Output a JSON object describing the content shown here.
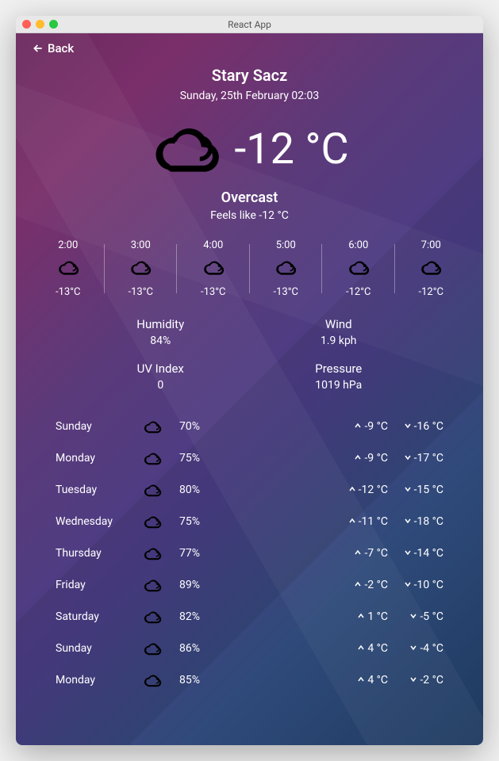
{
  "window": {
    "title": "React App"
  },
  "nav": {
    "back_label": "Back"
  },
  "location": {
    "city": "Stary Sacz",
    "datetime": "Sunday, 25th February 02:03"
  },
  "current": {
    "temp": "-12 °C",
    "condition": "Overcast",
    "feels_like": "Feels like -12 °C"
  },
  "hourly": [
    {
      "time": "2:00",
      "temp": "-13°C",
      "icon": "cloud"
    },
    {
      "time": "3:00",
      "temp": "-13°C",
      "icon": "cloud"
    },
    {
      "time": "4:00",
      "temp": "-13°C",
      "icon": "cloud"
    },
    {
      "time": "5:00",
      "temp": "-13°C",
      "icon": "cloud"
    },
    {
      "time": "6:00",
      "temp": "-12°C",
      "icon": "cloud"
    },
    {
      "time": "7:00",
      "temp": "-12°C",
      "icon": "cloud"
    }
  ],
  "stats": {
    "humidity": {
      "label": "Humidity",
      "value": "84%"
    },
    "wind": {
      "label": "Wind",
      "value": "1.9 kph"
    },
    "uv": {
      "label": "UV Index",
      "value": "0"
    },
    "pressure": {
      "label": "Pressure",
      "value": "1019 hPa"
    }
  },
  "daily": [
    {
      "day": "Sunday",
      "icon": "cloud",
      "precip": "70%",
      "high": "-9 °C",
      "low": "-16 °C"
    },
    {
      "day": "Monday",
      "icon": "cloud",
      "precip": "75%",
      "high": "-9 °C",
      "low": "-17 °C"
    },
    {
      "day": "Tuesday",
      "icon": "cloud",
      "precip": "80%",
      "high": "-12 °C",
      "low": "-15 °C"
    },
    {
      "day": "Wednesday",
      "icon": "cloud",
      "precip": "75%",
      "high": "-11 °C",
      "low": "-18 °C"
    },
    {
      "day": "Thursday",
      "icon": "cloud",
      "precip": "77%",
      "high": "-7 °C",
      "low": "-14 °C"
    },
    {
      "day": "Friday",
      "icon": "cloud",
      "precip": "89%",
      "high": "-2 °C",
      "low": "-10 °C"
    },
    {
      "day": "Saturday",
      "icon": "cloud",
      "precip": "82%",
      "high": "1 °C",
      "low": "-5 °C"
    },
    {
      "day": "Sunday",
      "icon": "cloud",
      "precip": "86%",
      "high": "4 °C",
      "low": "-4 °C"
    },
    {
      "day": "Monday",
      "icon": "cloud",
      "precip": "85%",
      "high": "4 °C",
      "low": "-2 °C"
    }
  ]
}
